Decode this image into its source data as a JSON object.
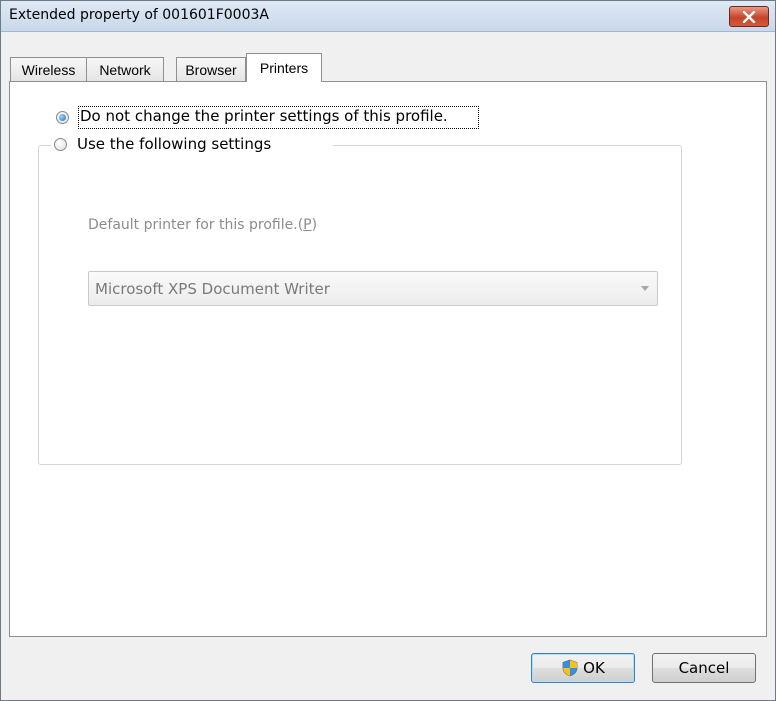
{
  "window": {
    "title": "Extended property of 001601F0003A"
  },
  "tabs": [
    {
      "label": "Wireless",
      "active": false
    },
    {
      "label": "Network",
      "active": false
    },
    {
      "label": "Browser",
      "active": false
    },
    {
      "label": "Printers",
      "active": true
    }
  ],
  "printers": {
    "option_no_change": "Do not change the printer settings of this profile.",
    "option_use_following": "Use the following settings",
    "default_printer_label": "Default printer for this profile.",
    "default_printer_label_mnemonic": "(P)",
    "default_printer_label_mnemonic_open": "(",
    "default_printer_label_mnemonic_key": "P",
    "default_printer_label_mnemonic_close": ")",
    "default_printer_value": "Microsoft XPS Document Writer"
  },
  "buttons": {
    "ok": "OK",
    "cancel": "Cancel"
  },
  "icons": {
    "close": "close-icon",
    "shield": "uac-shield-icon",
    "dropdown": "chevron-down-icon"
  },
  "colors": {
    "close_button": "#c7442a",
    "radio_selected": "#1f6fb8",
    "disabled_text": "#8c8c8c"
  }
}
